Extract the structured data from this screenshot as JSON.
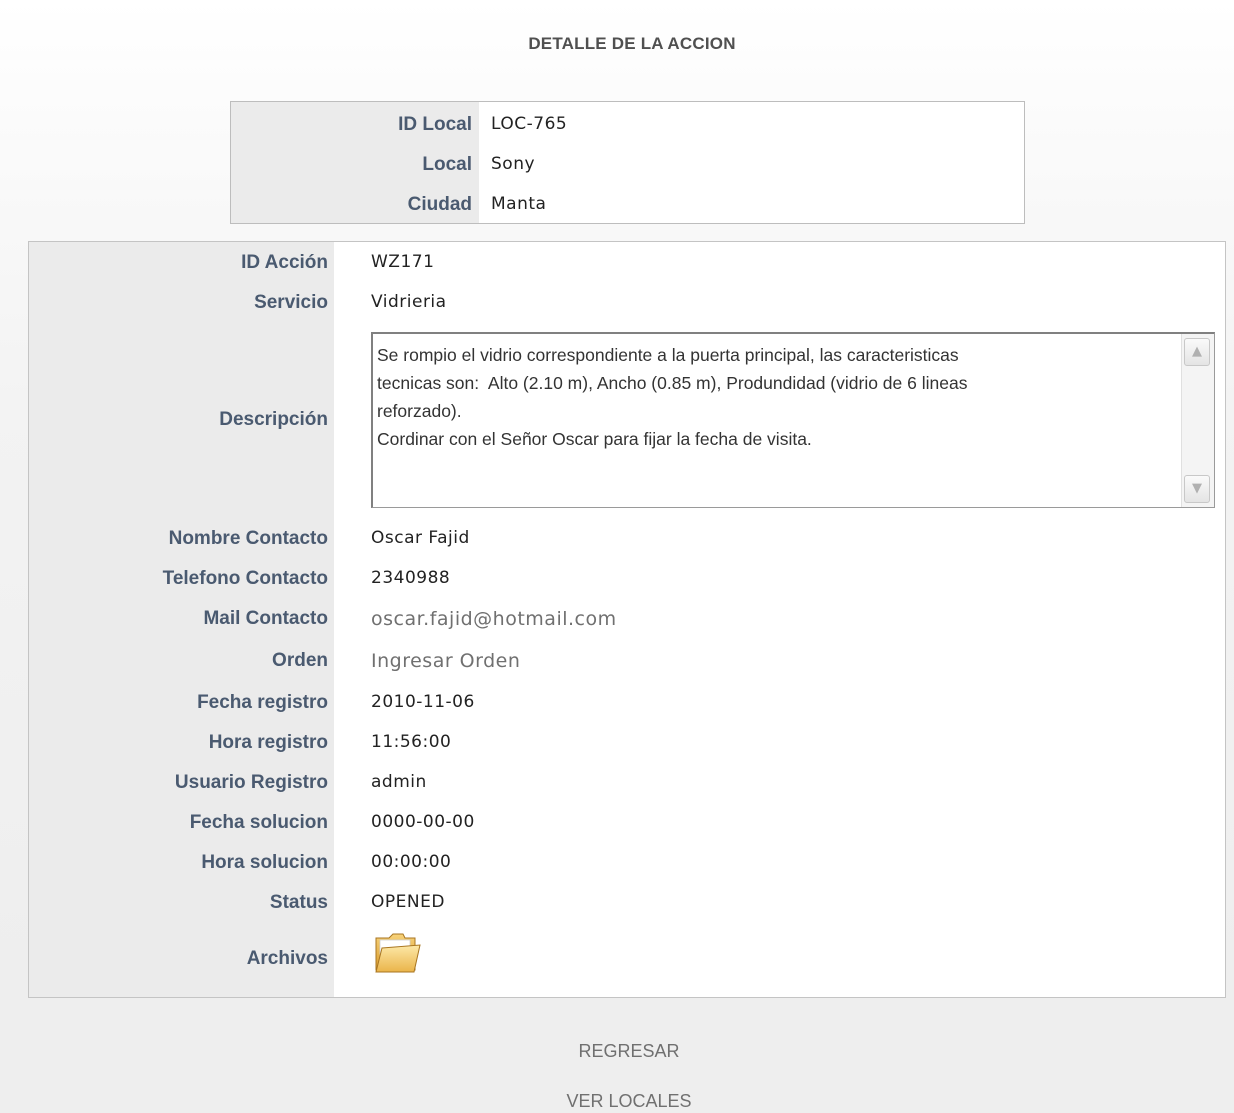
{
  "page": {
    "title": "DETALLE DE LA ACCION"
  },
  "local": {
    "rows": [
      {
        "label": "ID Local",
        "value": "LOC-765"
      },
      {
        "label": "Local",
        "value": "Sony"
      },
      {
        "label": "Ciudad",
        "value": "Manta"
      }
    ]
  },
  "detail": {
    "id_accion": {
      "label": "ID Acción",
      "value": "WZ171"
    },
    "servicio": {
      "label": "Servicio",
      "value": "Vidrieria"
    },
    "descripcion": {
      "label": "Descripción",
      "value": "Se rompio el vidrio correspondiente a la puerta principal, las caracteristicas\ntecnicas son:  Alto (2.10 m), Ancho (0.85 m), Produndidad (vidrio de 6 lineas\nreforzado).\nCordinar con el Señor Oscar para fijar la fecha de visita."
    },
    "nombre_contacto": {
      "label": "Nombre Contacto",
      "value": "Oscar Fajid"
    },
    "telefono_contacto": {
      "label": "Telefono Contacto",
      "value": "2340988"
    },
    "mail_contacto": {
      "label": "Mail Contacto",
      "value": "oscar.fajid@hotmail.com"
    },
    "orden": {
      "label": "Orden",
      "value": "Ingresar Orden"
    },
    "fecha_registro": {
      "label": "Fecha registro",
      "value": "2010-11-06"
    },
    "hora_registro": {
      "label": "Hora registro",
      "value": "11:56:00"
    },
    "usuario_registro": {
      "label": "Usuario Registro",
      "value": "admin"
    },
    "fecha_solucion": {
      "label": "Fecha solucion",
      "value": "0000-00-00"
    },
    "hora_solucion": {
      "label": "Hora solucion",
      "value": "00:00:00"
    },
    "status": {
      "label": "Status",
      "value": "OPENED"
    },
    "archivos": {
      "label": "Archivos",
      "icon": "folder-icon"
    }
  },
  "footer": {
    "regresar": "REGRESAR",
    "ver_locales": "VER LOCALES"
  },
  "colors": {
    "label_text": "#4a5a70",
    "label_column_bg": "#ebebeb",
    "link_text": "#707070"
  }
}
